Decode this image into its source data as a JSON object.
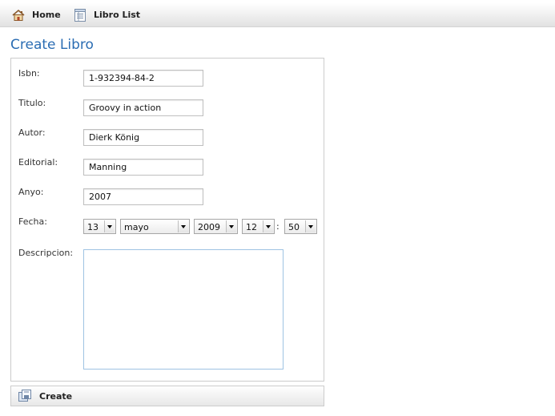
{
  "nav": {
    "home": {
      "label": "Home",
      "icon": "home-icon"
    },
    "list": {
      "label": "Libro List",
      "icon": "table-list-icon"
    }
  },
  "page": {
    "title": "Create Libro"
  },
  "form": {
    "isbn": {
      "label": "Isbn:",
      "value": "1-932394-84-2"
    },
    "titulo": {
      "label": "Titulo:",
      "value": "Groovy in action"
    },
    "autor": {
      "label": "Autor:",
      "value": "Dierk König"
    },
    "editorial": {
      "label": "Editorial:",
      "value": "Manning"
    },
    "anyo": {
      "label": "Anyo:",
      "value": "2007"
    },
    "fecha": {
      "label": "Fecha:",
      "day": "13",
      "month": "mayo",
      "year": "2009",
      "hour": "12",
      "separator": ":",
      "minute": "50"
    },
    "descripcion": {
      "label": "Descripcion:",
      "value": ""
    }
  },
  "buttons": {
    "create": {
      "label": "Create",
      "icon": "save-icon"
    }
  },
  "colors": {
    "title": "#2b6db3",
    "border": "#cccccc",
    "textarea_border": "#9fc3e3"
  }
}
